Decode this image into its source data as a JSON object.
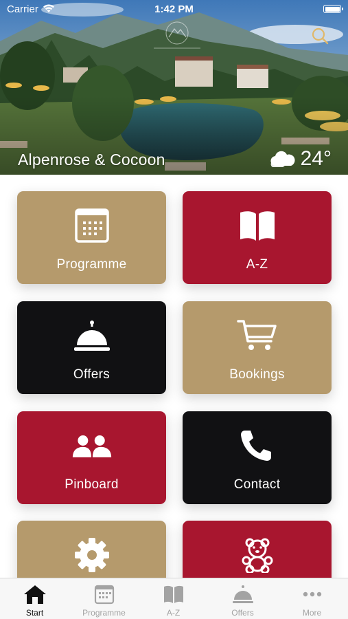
{
  "status_bar": {
    "carrier": "Carrier",
    "time": "1:42 PM"
  },
  "header": {
    "hotel_name": "Alpenrose & Cocoon",
    "weather_icon": "cloud-icon",
    "temperature": "24°",
    "search_icon": "search-icon"
  },
  "tiles": [
    {
      "label": "Programme",
      "icon": "calendar-icon",
      "color": "#b59a6c"
    },
    {
      "label": "A-Z",
      "icon": "book-icon",
      "color": "#a8162f"
    },
    {
      "label": "Offers",
      "icon": "service-bell-icon",
      "color": "#111113"
    },
    {
      "label": "Bookings",
      "icon": "cart-icon",
      "color": "#b59a6c"
    },
    {
      "label": "Pinboard",
      "icon": "users-icon",
      "color": "#a8162f"
    },
    {
      "label": "Contact",
      "icon": "phone-icon",
      "color": "#111113"
    },
    {
      "label": "",
      "icon": "gear-icon",
      "color": "#b59a6c"
    },
    {
      "label": "",
      "icon": "teddy-bear-icon",
      "color": "#a8162f"
    }
  ],
  "tabbar": {
    "active": "Start",
    "items": [
      {
        "label": "Start",
        "icon": "home-icon"
      },
      {
        "label": "Programme",
        "icon": "calendar-icon"
      },
      {
        "label": "A-Z",
        "icon": "book-icon"
      },
      {
        "label": "Offers",
        "icon": "service-bell-icon"
      },
      {
        "label": "More",
        "icon": "more-dots-icon"
      }
    ]
  }
}
